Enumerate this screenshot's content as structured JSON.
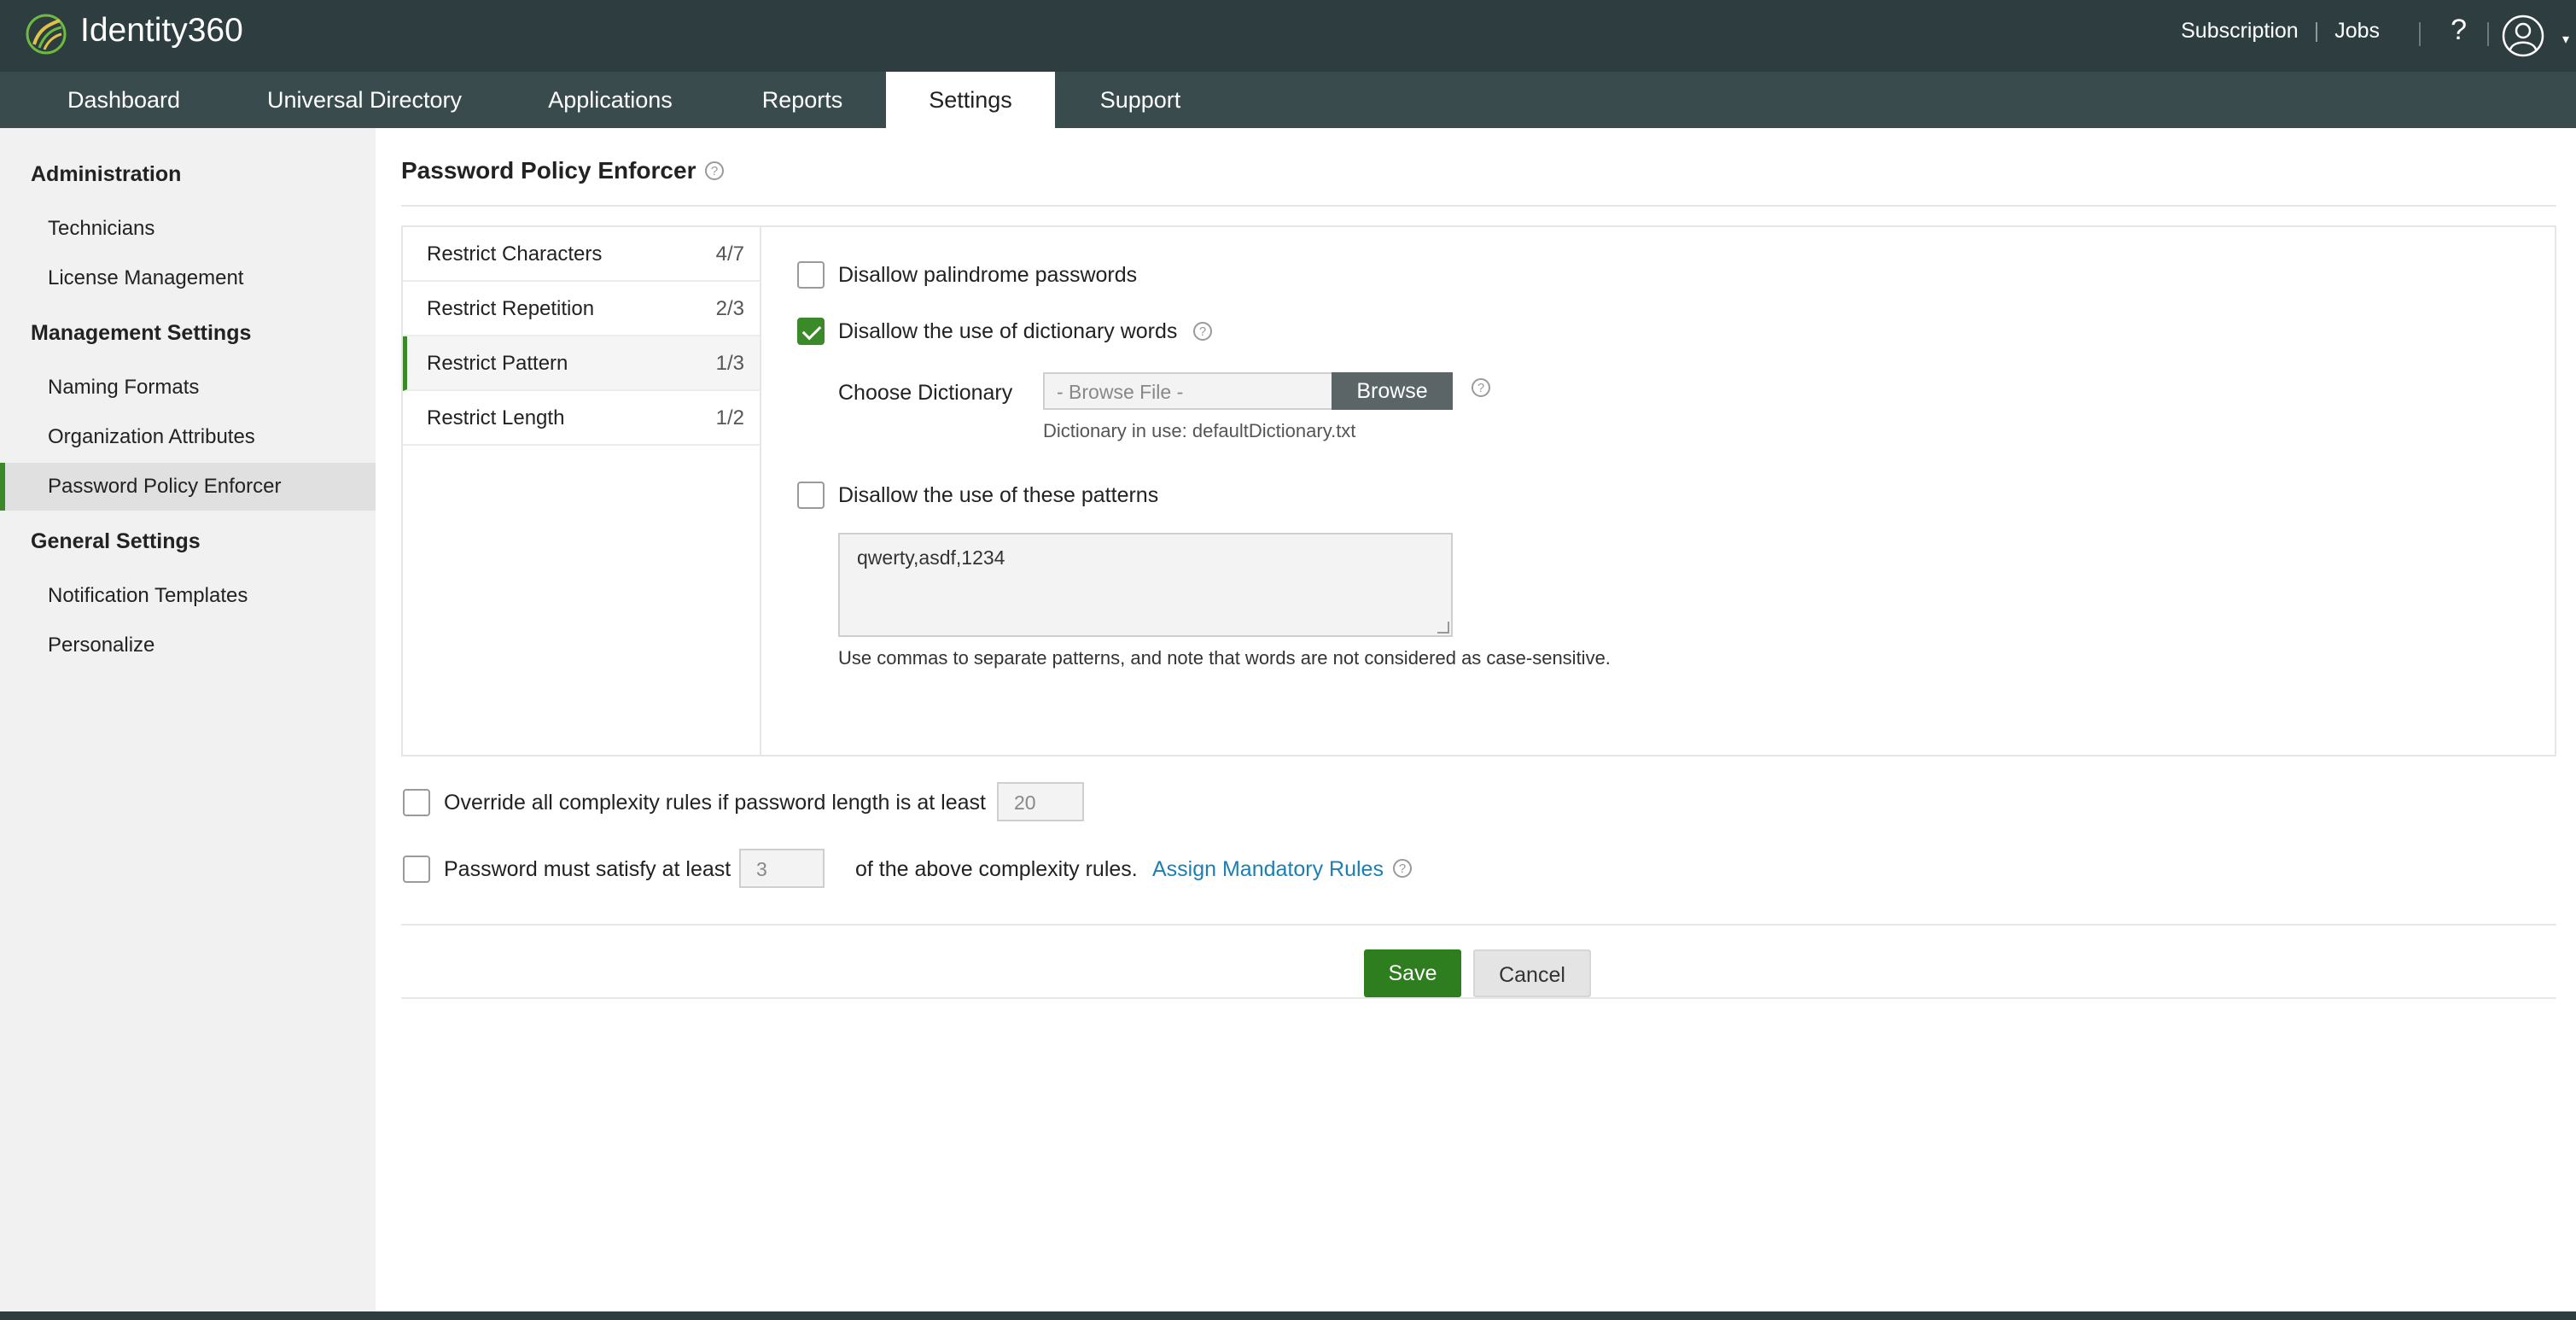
{
  "app": {
    "brand": "Identity360",
    "top_links": {
      "subscription": "Subscription",
      "separator": "|",
      "jobs": "Jobs",
      "help": "?"
    }
  },
  "nav": {
    "tabs": [
      "Dashboard",
      "Universal Directory",
      "Applications",
      "Reports",
      "Settings",
      "Support"
    ],
    "active": "Settings"
  },
  "sidebar": {
    "sections": [
      {
        "heading": "Administration",
        "items": [
          "Technicians",
          "License Management"
        ]
      },
      {
        "heading": "Management Settings",
        "items": [
          "Naming Formats",
          "Organization Attributes",
          "Password Policy Enforcer"
        ]
      },
      {
        "heading": "General Settings",
        "items": [
          "Notification Templates",
          "Personalize"
        ]
      }
    ],
    "active_item": "Password Policy Enforcer"
  },
  "page": {
    "title": "Password Policy Enforcer",
    "help_glyph": "?"
  },
  "rule_tabs": [
    {
      "label": "Restrict Characters",
      "count": "4/7"
    },
    {
      "label": "Restrict Repetition",
      "count": "2/3"
    },
    {
      "label": "Restrict Pattern",
      "count": "1/3"
    },
    {
      "label": "Restrict Length",
      "count": "1/2"
    }
  ],
  "active_rule_tab": "Restrict Pattern",
  "pattern_rules": {
    "palindrome": {
      "label": "Disallow palindrome passwords",
      "checked": false
    },
    "dictionary": {
      "label": "Disallow the use of dictionary words",
      "checked": true
    },
    "choose_dictionary_label": "Choose Dictionary",
    "file_placeholder": "- Browse File -",
    "browse_label": "Browse",
    "dictionary_in_use": "Dictionary in use: defaultDictionary.txt",
    "patterns": {
      "label": "Disallow the use of these patterns",
      "checked": false
    },
    "patterns_value": "qwerty,asdf,1234",
    "patterns_hint": "Use commas to separate patterns, and note that words are not considered as case-sensitive."
  },
  "override": {
    "label": "Override all complexity rules if password length is at least",
    "value": "20",
    "checked": false
  },
  "satisfy": {
    "label_before": "Password must satisfy at least",
    "value": "3",
    "label_after": "of the above complexity rules.",
    "link": "Assign Mandatory Rules",
    "checked": false
  },
  "actions": {
    "save": "Save",
    "cancel": "Cancel"
  },
  "colors": {
    "header": "#2d3d40",
    "nav": "#3a4b4e",
    "accent": "#3a8a2a",
    "link": "#1b7fb4"
  }
}
